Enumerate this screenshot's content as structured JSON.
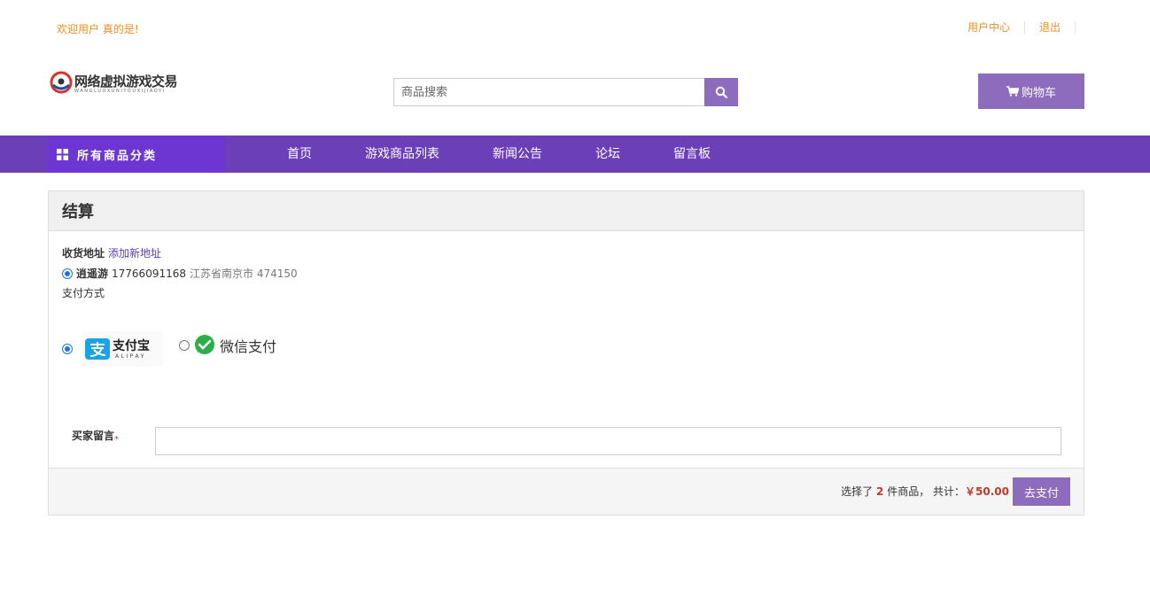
{
  "top": {
    "welcome": "欢迎用户 真的是!",
    "links": [
      "用户中心",
      "退出"
    ]
  },
  "logo": {
    "title": "网络虚拟游戏交易",
    "subtitle": "WANGLUOXUNIYOUXIJIAOYI"
  },
  "search": {
    "placeholder": "商品搜索"
  },
  "cart": {
    "label": "购物车"
  },
  "nav": {
    "category_label": "所有商品分类",
    "items": [
      "首页",
      "游戏商品列表",
      "新闻公告",
      "论坛",
      "留言板"
    ]
  },
  "checkout": {
    "title": "结算",
    "address_label": "收货地址",
    "add_address_link": "添加新地址",
    "address": {
      "name": "逍遥游",
      "phone": "17766091168",
      "place": "江苏省南京市 474150",
      "selected": true
    },
    "payment_label": "支付方式",
    "payment_options": [
      {
        "name": "支付宝",
        "sub": "ALIPAY",
        "selected": true
      },
      {
        "name": "微信支付",
        "selected": false
      }
    ],
    "message_label": "买家留言",
    "message_required_mark": "*",
    "message_value": "",
    "summary_prefix": "选择了",
    "summary_count": "2",
    "summary_mid": "件商品，  共计：",
    "summary_total": "￥50.00",
    "pay_button": "去支付"
  },
  "colors": {
    "accent": "#8e6cbd",
    "nav_bg": "#6a3fb8",
    "nav_category_bg": "#6d36d3",
    "link_orange": "#e8902a",
    "price_red": "#c0392b"
  }
}
